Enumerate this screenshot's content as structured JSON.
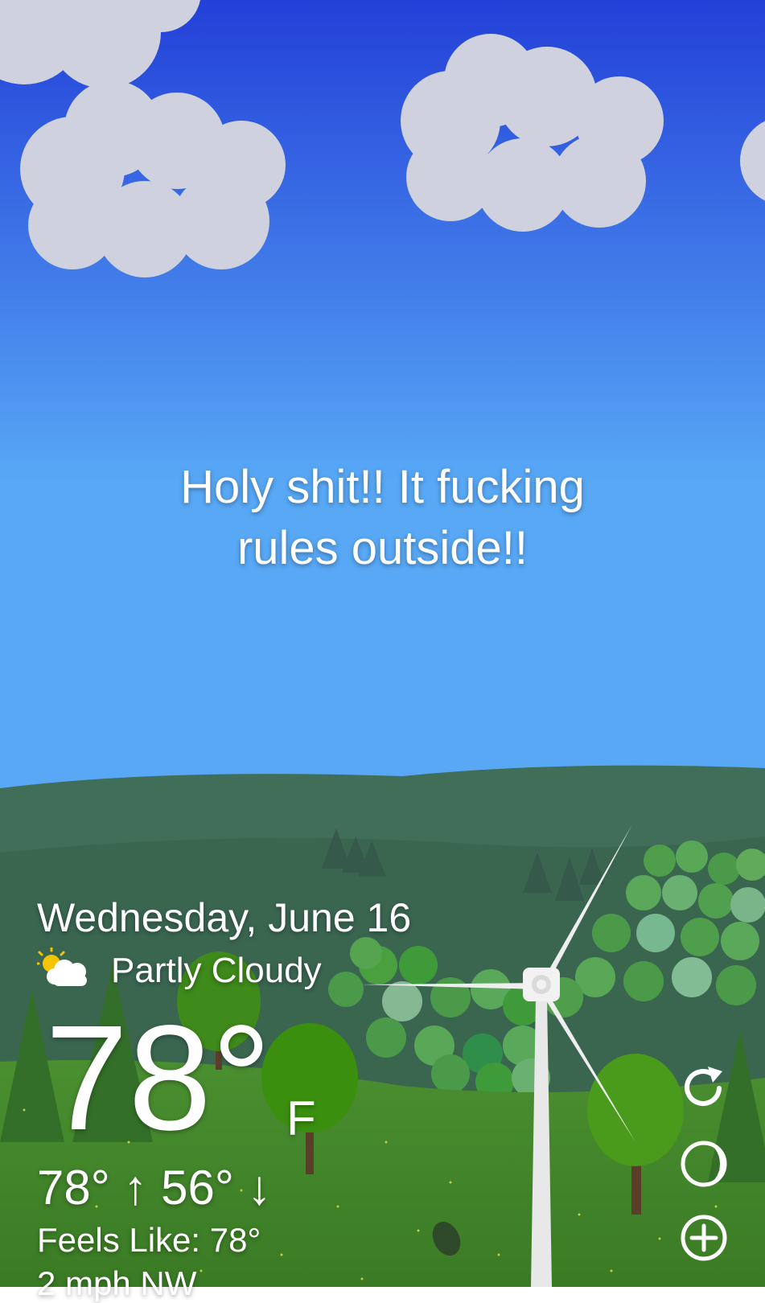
{
  "message": {
    "line1": "Holy shit!! It fucking",
    "line2": "rules outside!!"
  },
  "weather": {
    "date": "Wednesday, June 16",
    "condition": "Partly Cloudy",
    "condition_icon": "partly-cloudy-icon",
    "temperature": "78°",
    "unit": "F",
    "high": "78°",
    "low": "56°",
    "feels_like": "Feels Like: 78°",
    "wind": "2 mph NW"
  },
  "actions": {
    "refresh_icon": "refresh-icon",
    "moon_icon": "moon-phase-icon",
    "add_icon": "add-location-icon"
  },
  "colors": {
    "sky_top": "#2340d8",
    "sky_bottom": "#58a8f6",
    "hill_far": "#3d6a54",
    "meadow": "#3f8a2a",
    "cloud": "#cfd2de"
  }
}
